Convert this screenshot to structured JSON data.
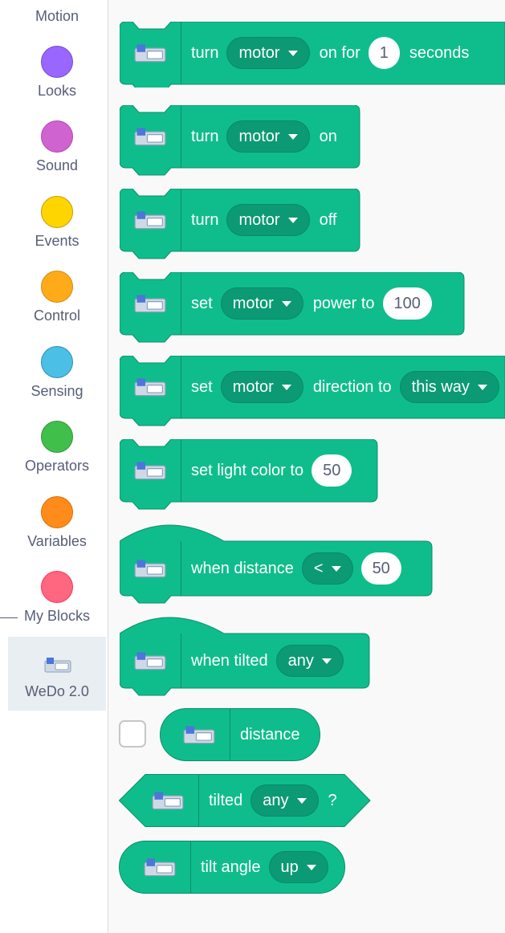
{
  "colors": {
    "motion": "#4c97ff",
    "looks": "#9966ff",
    "sound": "#cf63cf",
    "events": "#ffd500",
    "control": "#ffab19",
    "sensing": "#4cbfe6",
    "operators": "#40bf4a",
    "variables": "#ff8c1a",
    "my_blocks": "#ff6680",
    "extension": "#0fbd8c",
    "extension_dark": "#0b9a74"
  },
  "sidebar": {
    "categories": [
      {
        "label": "Motion"
      },
      {
        "label": "Looks"
      },
      {
        "label": "Sound"
      },
      {
        "label": "Events"
      },
      {
        "label": "Control"
      },
      {
        "label": "Sensing"
      },
      {
        "label": "Operators"
      },
      {
        "label": "Variables"
      },
      {
        "label": "My Blocks"
      },
      {
        "label": "WeDo 2.0",
        "icon": "wedo-hub-icon",
        "selected": true
      }
    ]
  },
  "blocks": {
    "turn_on_for": {
      "turn": "turn",
      "motor": "motor",
      "on_for": "on for",
      "seconds_value": "1",
      "seconds": "seconds"
    },
    "turn_on": {
      "turn": "turn",
      "motor": "motor",
      "on": "on"
    },
    "turn_off": {
      "turn": "turn",
      "motor": "motor",
      "off": "off"
    },
    "set_power": {
      "set": "set",
      "motor": "motor",
      "power_to": "power to",
      "value": "100"
    },
    "set_direction": {
      "set": "set",
      "motor": "motor",
      "direction_to": "direction to",
      "direction": "this way"
    },
    "set_light": {
      "label": "set light color to",
      "value": "50"
    },
    "when_distance": {
      "label": "when distance",
      "operator": "<",
      "value": "50"
    },
    "when_tilted": {
      "label": "when tilted",
      "direction": "any"
    },
    "distance": {
      "label": "distance"
    },
    "tilted": {
      "label": "tilted",
      "direction": "any",
      "question": "?"
    },
    "tilt_angle": {
      "label": "tilt angle",
      "direction": "up"
    }
  }
}
